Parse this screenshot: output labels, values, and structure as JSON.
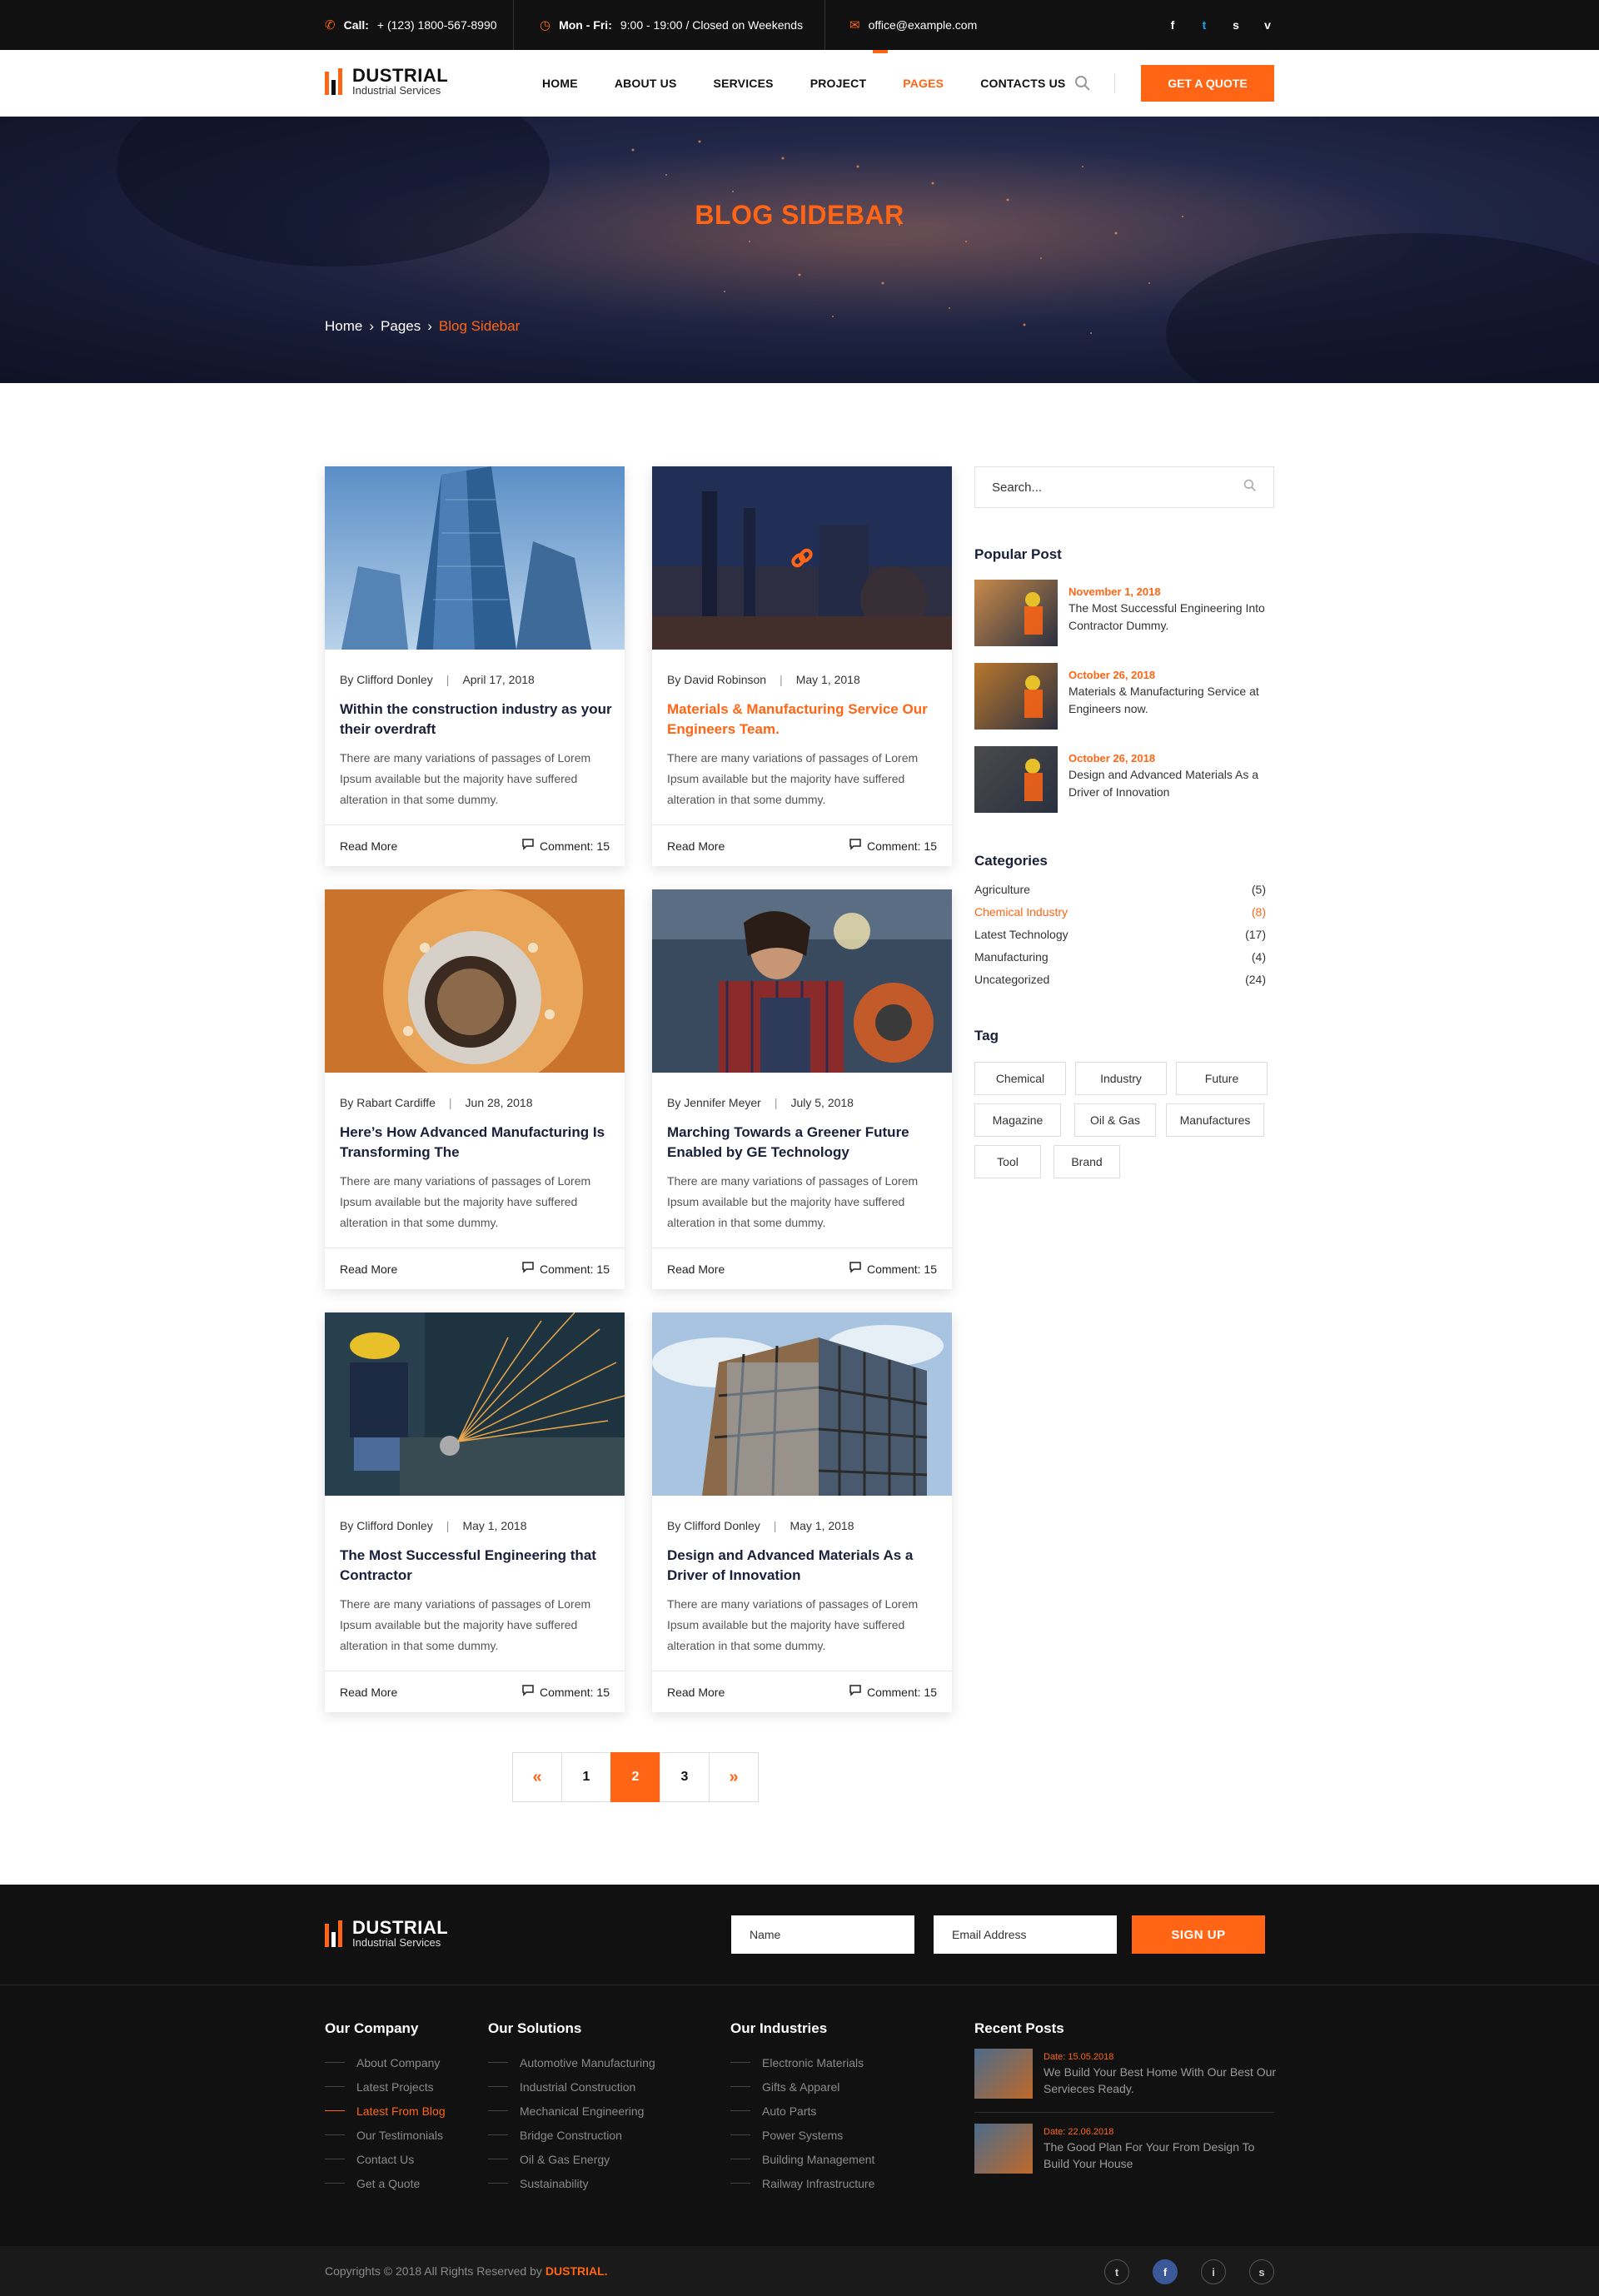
{
  "topbar": {
    "call_label": "Call:",
    "call_value": "+ (123) 1800-567-8990",
    "hours_label": "Mon - Fri:",
    "hours_value": "9:00 - 19:00 / Closed on Weekends",
    "email": "office@example.com",
    "social": [
      "f",
      "t",
      "s",
      "v"
    ]
  },
  "brand": {
    "name": "DUSTRIAL",
    "tagline": "Industrial Services",
    "accent": "#ff6514"
  },
  "nav": {
    "items": [
      "HOME",
      "ABOUT US",
      "SERVICES",
      "PROJECT",
      "PAGES",
      "CONTACTS US"
    ],
    "active_index": 4,
    "cta": "GET A QUOTE"
  },
  "hero": {
    "title": "BLOG SIDEBAR",
    "breadcrumb": [
      "Home",
      "Pages",
      "Blog Sidebar"
    ]
  },
  "posts": [
    {
      "author": "By Clifford Donley",
      "date": "April 17, 2018",
      "title": "Within the construction industry as your their overdraft",
      "excerpt": "There are many variations of passages of Lorem Ipsum available but the majority have suffered alteration in that  some dummy.",
      "read_more": "Read More",
      "comments": "Comment: 15",
      "highlight": false
    },
    {
      "author": "By David Robinson",
      "date": "May 1, 2018",
      "title": "Materials & Manufacturing Service Our Engineers Team.",
      "excerpt": "There are many variations of passages of Lorem Ipsum available but the majority have suffered alteration in that  some dummy.",
      "read_more": "Read More",
      "comments": "Comment: 15",
      "highlight": true
    },
    {
      "author": "By Rabart Cardiffe",
      "date": "Jun 28, 2018",
      "title": "Here’s How Advanced Manufacturing Is Transforming The",
      "excerpt": "There are many variations of passages of Lorem Ipsum available but the majority have suffered alteration in that  some dummy.",
      "read_more": "Read More",
      "comments": "Comment: 15",
      "highlight": false
    },
    {
      "author": "By Jennifer Meyer",
      "date": "July 5, 2018",
      "title": "Marching Towards a Greener Future Enabled by GE Technology",
      "excerpt": "There are many variations of passages of Lorem Ipsum available but the majority have suffered alteration in that  some dummy.",
      "read_more": "Read More",
      "comments": "Comment: 15",
      "highlight": false
    },
    {
      "author": "By Clifford Donley",
      "date": "May 1, 2018",
      "title": "The Most Successful Engineering that Contractor",
      "excerpt": "There are many variations of passages of Lorem Ipsum available but the majority have suffered alteration in that  some dummy.",
      "read_more": "Read More",
      "comments": "Comment: 15",
      "highlight": false
    },
    {
      "author": "By Clifford Donley",
      "date": "May 1, 2018",
      "title": "Design and Advanced Materials As a Driver of Innovation",
      "excerpt": "There are many variations of passages of Lorem Ipsum available but the majority have suffered alteration in that  some dummy.",
      "read_more": "Read More",
      "comments": "Comment: 15",
      "highlight": false
    }
  ],
  "pagination": {
    "prev": "«",
    "pages": [
      "1",
      "2",
      "3"
    ],
    "current": "2",
    "next": "»"
  },
  "sidebar": {
    "search_placeholder": "Search...",
    "popular_heading": "Popular Post",
    "popular": [
      {
        "date": "November 1, 2018",
        "title": "The Most Successful Engineering Into Contractor Dummy."
      },
      {
        "date": "October 26, 2018",
        "title": "Materials & Manufacturing Service at Engineers now."
      },
      {
        "date": "October 26, 2018",
        "title": "Design and Advanced Materials As a Driver of Innovation"
      }
    ],
    "categories_heading": "Categories",
    "categories": [
      {
        "name": "Agriculture",
        "count": "(5)"
      },
      {
        "name": "Chemical Industry",
        "count": "(8)"
      },
      {
        "name": "Latest Technology",
        "count": "(17)"
      },
      {
        "name": "Manufacturing",
        "count": "(4)"
      },
      {
        "name": "Uncategorized",
        "count": "(24)"
      }
    ],
    "categories_active_index": 1,
    "tag_heading": "Tag",
    "tags": [
      "Chemical",
      "Industry",
      "Future",
      "Magazine",
      "Oil & Gas",
      "Manufactures",
      "Tool",
      "Brand"
    ]
  },
  "footer": {
    "name_placeholder": "Name",
    "email_placeholder": "Email Address",
    "signup": "SIGN UP",
    "company_heading": "Our Company",
    "company_links": [
      "About Company",
      "Latest Projects",
      "Latest From Blog",
      "Our Testimonials",
      "Contact Us",
      "Get a Quote"
    ],
    "company_active_index": 2,
    "solutions_heading": "Our Solutions",
    "solutions_links": [
      "Automotive Manufacturing",
      "Industrial Construction",
      "Mechanical Engineering",
      "Bridge Construction",
      "Oil & Gas Energy",
      "Sustainability"
    ],
    "industries_heading": "Our Industries",
    "industries_links": [
      "Electronic Materials",
      "Gifts & Apparel",
      "Auto Parts",
      "Power Systems",
      "Building Management",
      "Railway Infrastructure"
    ],
    "recent_heading": "Recent Posts",
    "recent": [
      {
        "date": "Date: 15.05.2018",
        "title": "We Build Your Best Home With Our Best Our Servieces Ready."
      },
      {
        "date": "Date: 22.06.2018",
        "title": "The Good Plan For Your From Design To Build Your House"
      }
    ],
    "copyright": "Copyrights © 2018 All Rights Reserved by",
    "copyright_brand": "DUSTRIAL.",
    "social": [
      "t",
      "f",
      "i",
      "s"
    ]
  }
}
